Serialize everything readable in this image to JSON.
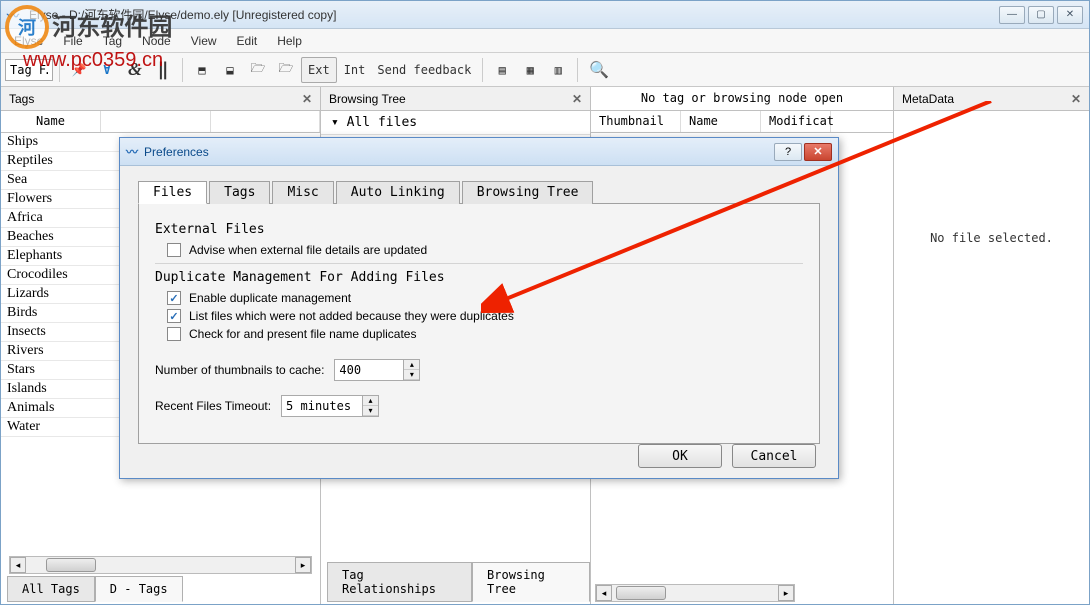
{
  "window": {
    "title": "Elyse - D:/河东软件园/Elyse/demo.ely [Unregistered copy]"
  },
  "menu": [
    "Elyse",
    "File",
    "Tag",
    "Node",
    "View",
    "Edit",
    "Help"
  ],
  "toolbar": {
    "tag_filter_text": "Tag F…",
    "ext_btn": "Ext",
    "int_btn": "Int",
    "send_feedback": "Send feedback"
  },
  "panels": {
    "tags_title": "Tags",
    "browsing_title": "Browsing Tree",
    "no_tag_open": "No tag or browsing node open",
    "metadata_title": "MetaData",
    "all_files": "▾ All files",
    "name_col": "Name",
    "thumb_col": "Thumbnail",
    "fname_col": "Name",
    "mod_col": "Modificat",
    "no_file_sel": "No file selected."
  },
  "tags": [
    "Ships",
    "Reptiles",
    "Sea",
    "Flowers",
    "Africa",
    "Beaches",
    "Elephants",
    "Crocodiles",
    "Lizards",
    "Birds",
    "Insects",
    "Rivers",
    "Stars",
    "Islands",
    "Animals",
    "Water"
  ],
  "bottom_tabs": {
    "all_tags": "All Tags",
    "d_tags": "D - Tags"
  },
  "bottom_tabs2": {
    "tag_rel": "Tag Relationships",
    "browsing": "Browsing Tree"
  },
  "dialog": {
    "title": "Preferences",
    "tabs": [
      "Files",
      "Tags",
      "Misc",
      "Auto Linking",
      "Browsing Tree"
    ],
    "ext_files_heading": "External Files",
    "advise_external": "Advise when external file details are updated",
    "dup_heading": "Duplicate Management For Adding Files",
    "enable_dup": "Enable duplicate management",
    "list_not_added": "List files which were not added because they were duplicates",
    "check_name_dup": "Check for and present file name duplicates",
    "thumb_cache_label": "Number of thumbnails to cache:",
    "thumb_cache_value": "400",
    "recent_timeout_label": "Recent Files Timeout:",
    "recent_timeout_value": "5 minutes",
    "ok": "OK",
    "cancel": "Cancel"
  },
  "watermark": {
    "name": "河东软件园",
    "url": "www.pc0359.cn"
  }
}
